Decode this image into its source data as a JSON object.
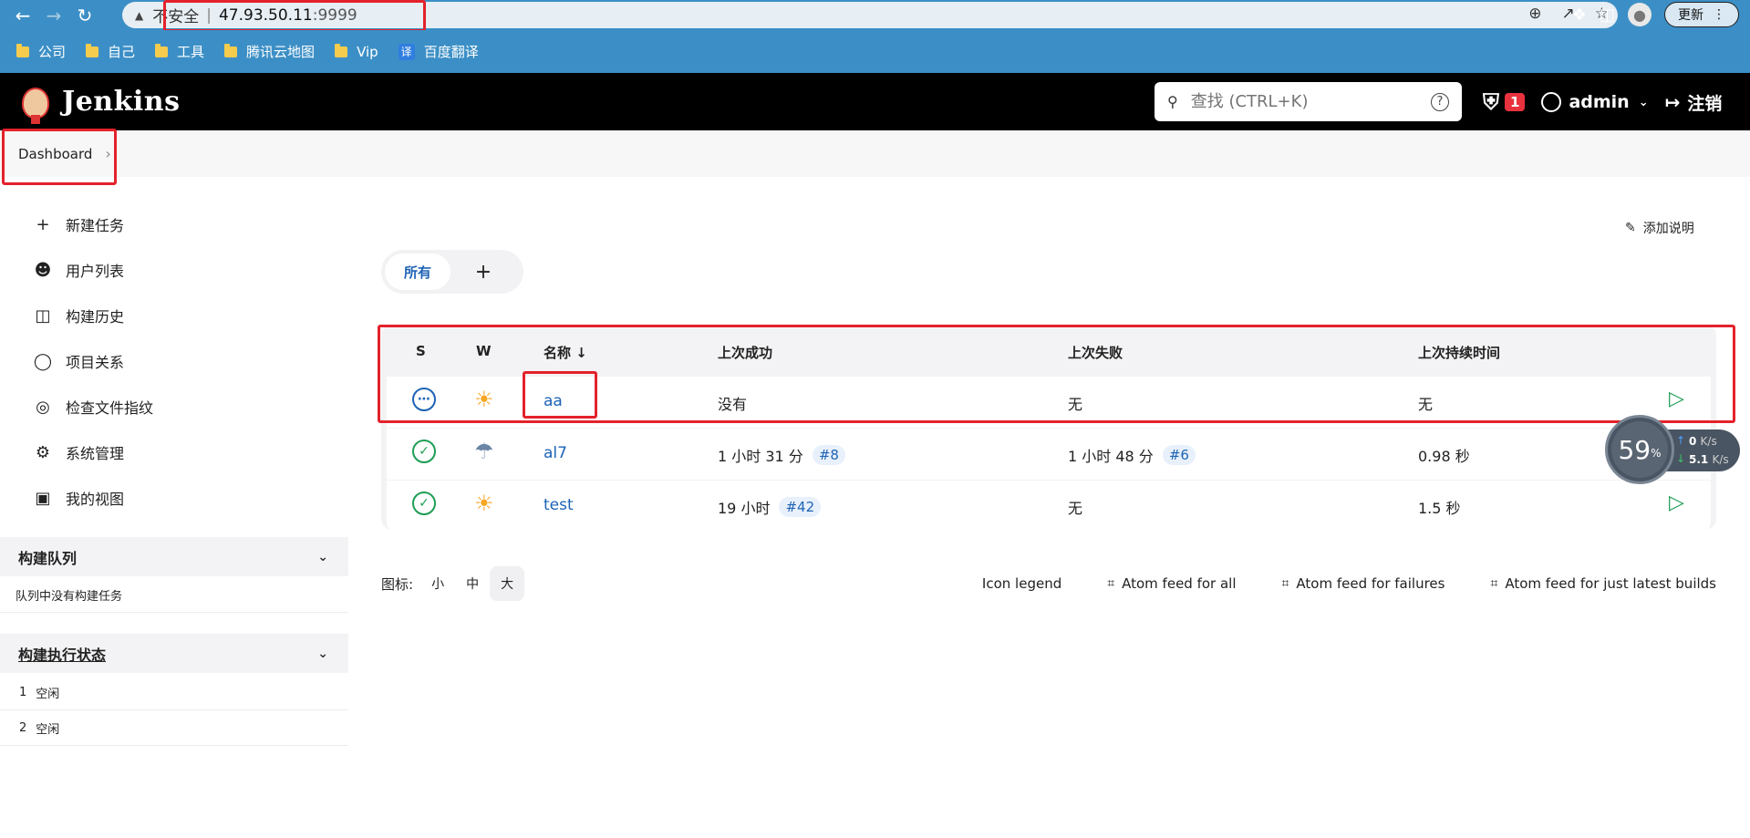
{
  "browser": {
    "security_warning": "不安全",
    "host": "47.93.50.11",
    "port": ":9999",
    "update_label": "更新"
  },
  "bookmarks": [
    "公司",
    "自己",
    "工具",
    "腾讯云地图",
    "Vip",
    "百度翻译"
  ],
  "translate_badge": "译",
  "jenkins": {
    "title": "Jenkins",
    "search_placeholder": "查找 (CTRL+K)",
    "alert_count": "1",
    "user": "admin",
    "logout": "注销"
  },
  "breadcrumb": "Dashboard",
  "sidebar": {
    "items": [
      "新建任务",
      "用户列表",
      "构建历史",
      "项目关系",
      "检查文件指纹",
      "系统管理",
      "我的视图"
    ],
    "icons": [
      "plus-icon",
      "users-icon",
      "inbox-icon",
      "relation-icon",
      "fingerprint-icon",
      "gear-icon",
      "window-icon"
    ]
  },
  "build_queue": {
    "title": "构建队列",
    "empty_text": "队列中没有构建任务"
  },
  "executors": {
    "title": "构建执行状态",
    "rows": [
      {
        "num": "1",
        "state": "空闲"
      },
      {
        "num": "2",
        "state": "空闲"
      }
    ]
  },
  "add_description": "添加说明",
  "tabs": {
    "all": "所有",
    "add": "+"
  },
  "table": {
    "headers": {
      "s": "S",
      "w": "W",
      "name": "名称 ↓",
      "last_success": "上次成功",
      "last_failure": "上次失败",
      "last_duration": "上次持续时间"
    },
    "rows": [
      {
        "name": "aa",
        "last_success": "没有",
        "success_build": "",
        "last_failure": "无",
        "failure_build": "",
        "duration": "无",
        "status": "pending",
        "weather": "sunny",
        "play": true
      },
      {
        "name": "al7",
        "last_success": "1 小时 31 分",
        "success_build": "#8",
        "last_failure": "1 小时 48 分",
        "failure_build": "#6",
        "duration": "0.98 秒",
        "status": "success",
        "weather": "rain",
        "play": false
      },
      {
        "name": "test",
        "last_success": "19 小时",
        "success_build": "#42",
        "last_failure": "无",
        "failure_build": "",
        "duration": "1.5 秒",
        "status": "success",
        "weather": "sunny",
        "play": true
      }
    ]
  },
  "footer": {
    "icon_label": "图标:",
    "sizes": [
      "小",
      "中",
      "大"
    ],
    "icon_legend": "Icon legend",
    "feeds": [
      "Atom feed for all",
      "Atom feed for failures",
      "Atom feed for just latest builds"
    ]
  },
  "net_widget": {
    "percent": "59",
    "unit": "%",
    "up": "0",
    "up_unit": "K/s",
    "down": "5.1",
    "down_unit": "K/s"
  },
  "colors": {
    "accent": "#1e63b5",
    "success": "#1f9d55",
    "annotation": "#e3222b",
    "browser_bar": "#3c8fc6"
  }
}
